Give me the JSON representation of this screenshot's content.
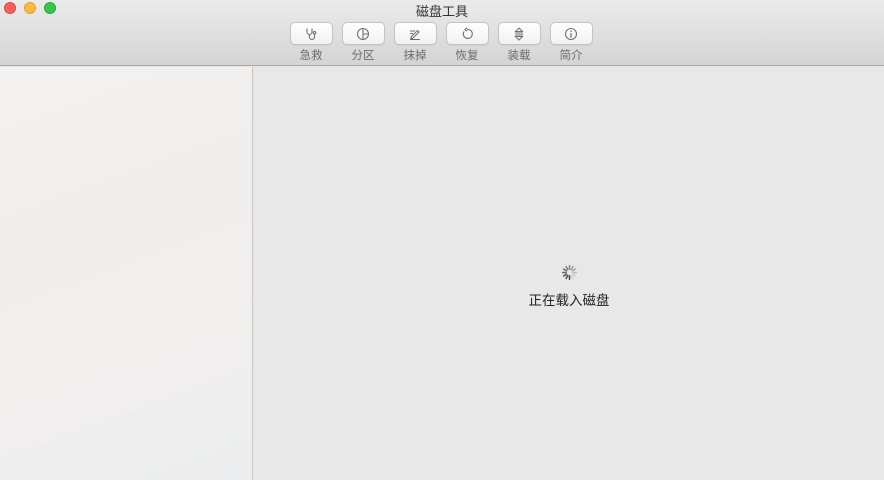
{
  "window": {
    "title": "磁盘工具"
  },
  "toolbar": {
    "items": [
      {
        "label": "急救",
        "icon": "stethoscope-icon"
      },
      {
        "label": "分区",
        "icon": "pie-chart-icon"
      },
      {
        "label": "抹掉",
        "icon": "erase-icon"
      },
      {
        "label": "恢复",
        "icon": "restore-icon"
      },
      {
        "label": "装载",
        "icon": "mount-icon"
      },
      {
        "label": "简介",
        "icon": "info-icon"
      }
    ]
  },
  "main": {
    "loading_text": "正在载入磁盘"
  },
  "colors": {
    "close": "#fc605b",
    "minimize": "#fdbc40",
    "maximize": "#34c84a",
    "sidebar_bg": "#f2f0ef",
    "main_bg": "#e8e8e8"
  }
}
